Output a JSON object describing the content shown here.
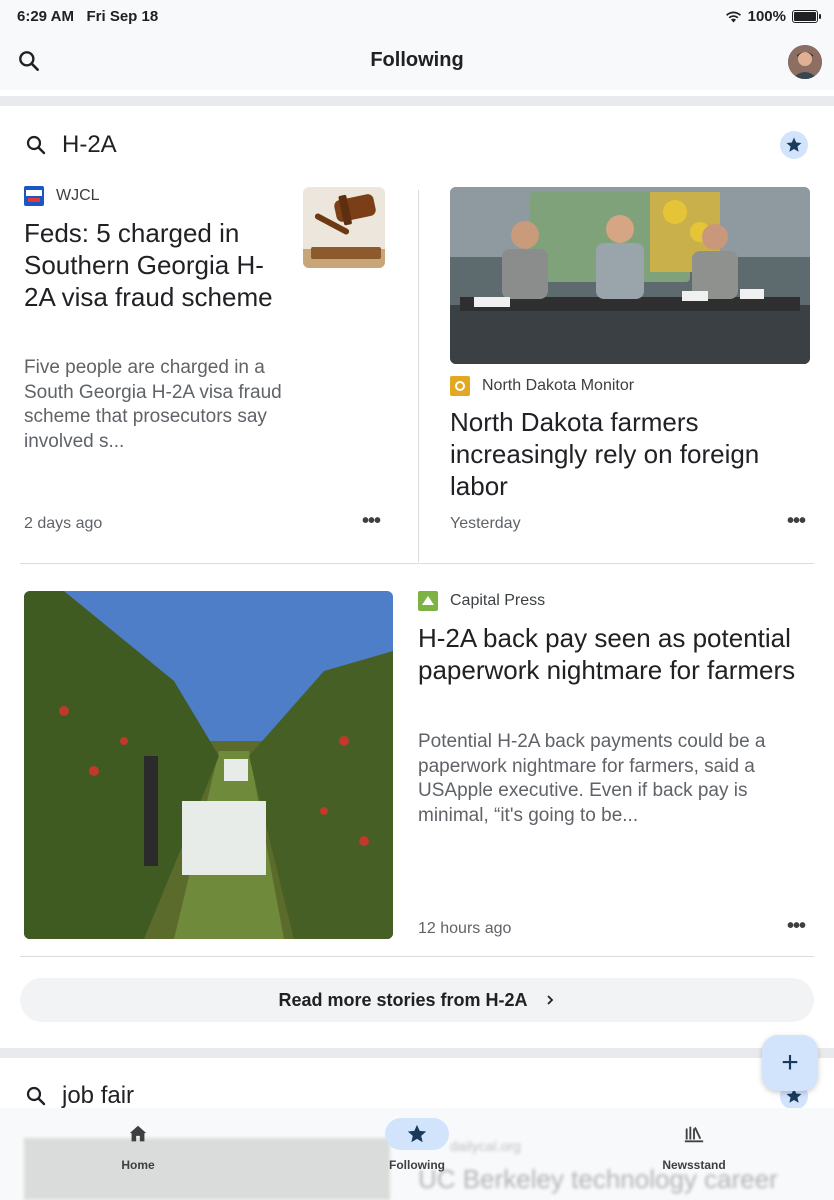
{
  "status_bar": {
    "time": "6:29 AM",
    "date": "Fri Sep 18",
    "battery": "100%",
    "battery_level": 1.0
  },
  "header": {
    "title": "Following",
    "search_icon": "search-icon",
    "avatar_icon": "user-avatar"
  },
  "topics": [
    {
      "title": "H-2A",
      "starred": true,
      "articles": [
        {
          "source": "WJCL",
          "source_logo_color": "#1a57c4",
          "headline": "Feds: 5 charged in Southern Georgia H-2A visa fraud scheme",
          "snippet": "Five people are charged in a South Georgia H-2A visa fraud scheme that prosecutors say involved s...",
          "time": "2 days ago",
          "image": "gavel-thumbnail"
        },
        {
          "source": "North Dakota Monitor",
          "source_logo_color": "#e3a822",
          "headline": "North Dakota farmers increasingly rely on foreign labor",
          "time": "Yesterday",
          "image": "panel-discussion-photo"
        },
        {
          "source": "Capital Press",
          "source_logo_color": "#7cb342",
          "headline": "H-2A back pay seen as potential paperwork nightmare for farmers",
          "snippet": "Potential H-2A back payments could be a paperwork nightmare for farmers, said a USApple executive. Even if back pay is minimal, “it's going to be...",
          "time": "12 hours ago",
          "image": "apple-orchard-photo"
        }
      ],
      "read_more": "Read more stories from H-2A"
    },
    {
      "title": "job fair",
      "starred": true,
      "peek_source": "dailycal.org",
      "peek_headline": "UC Berkeley technology career"
    }
  ],
  "fab": {
    "label": "+"
  },
  "bottom_nav": {
    "items": [
      {
        "label": "Home",
        "icon": "home-icon"
      },
      {
        "label": "Following",
        "icon": "star-icon",
        "active": true
      },
      {
        "label": "Newsstand",
        "icon": "newsstand-icon"
      }
    ]
  },
  "colors": {
    "accent": "#1a3a5c",
    "accent_bg": "#d2e3fc",
    "surface": "#f8f9fa"
  }
}
